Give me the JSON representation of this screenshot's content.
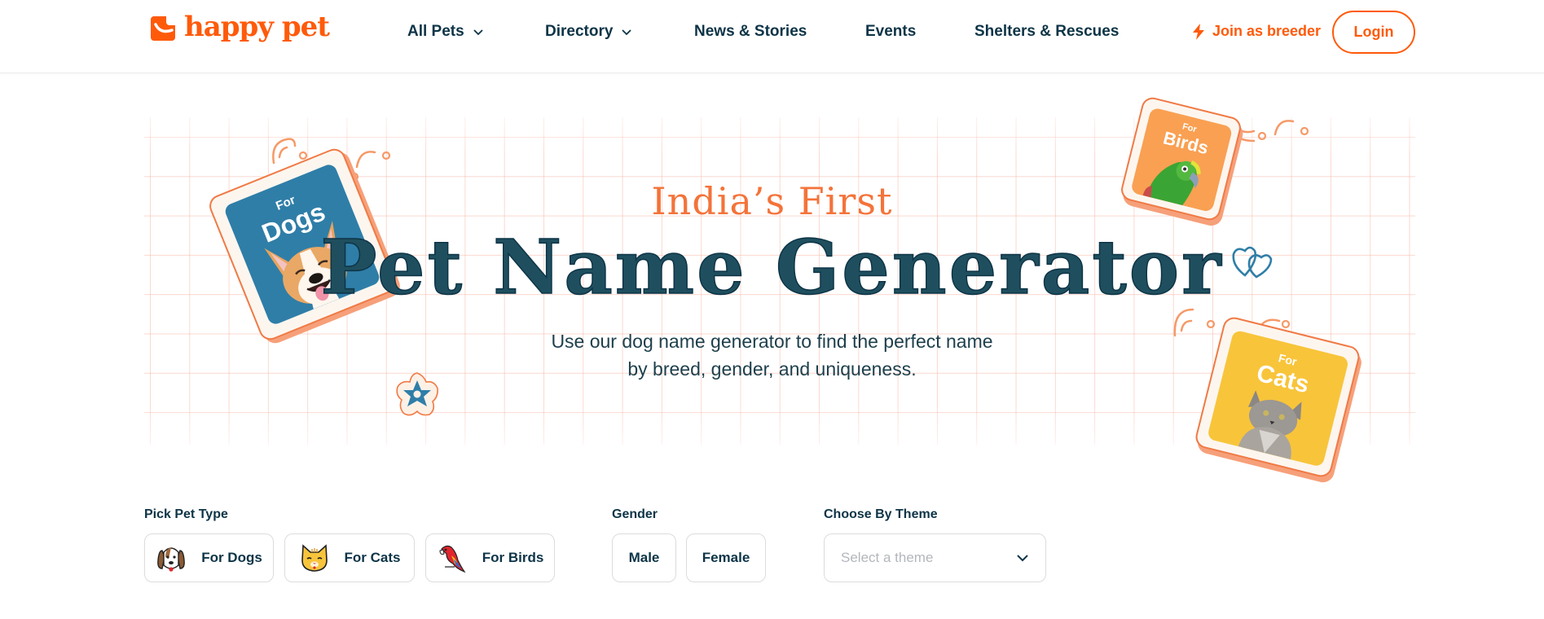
{
  "brand": {
    "name": "happy pet",
    "accent_color": "#ff5a0a",
    "text_color": "#0d3447"
  },
  "nav": {
    "items": [
      {
        "label": "All Pets",
        "has_dropdown": true
      },
      {
        "label": "Directory",
        "has_dropdown": true
      },
      {
        "label": "News & Stories",
        "has_dropdown": false
      },
      {
        "label": "Events",
        "has_dropdown": false
      },
      {
        "label": "Shelters & Rescues",
        "has_dropdown": false
      }
    ],
    "join_label": "Join as breeder",
    "join_icon": "lightning-icon",
    "login_label": "Login"
  },
  "hero": {
    "eyebrow": "India’s First",
    "title": "Pet Name Generator",
    "subtitle_line1": "Use our dog name generator to find the perfect name",
    "subtitle_line2": "by breed, gender, and uniqueness.",
    "cards": [
      {
        "for": "For",
        "label": "Dogs",
        "color": "#2f7ea8",
        "image": "smiling corgi dog"
      },
      {
        "for": "For",
        "label": "Birds",
        "color": "#f9a052",
        "image": "green parrot"
      },
      {
        "for": "For",
        "label": "Cats",
        "color": "#f8c43a",
        "image": "tabby cat looking up"
      }
    ]
  },
  "form": {
    "pet_type": {
      "label": "Pick Pet Type",
      "options": [
        {
          "label": "For Dogs",
          "icon": "dog-face-icon"
        },
        {
          "label": "For Cats",
          "icon": "cat-face-icon"
        },
        {
          "label": "For Birds",
          "icon": "parrot-icon"
        }
      ]
    },
    "gender": {
      "label": "Gender",
      "options": [
        {
          "label": "Male"
        },
        {
          "label": "Female"
        }
      ]
    },
    "theme": {
      "label": "Choose By Theme",
      "placeholder": "Select a theme"
    }
  }
}
